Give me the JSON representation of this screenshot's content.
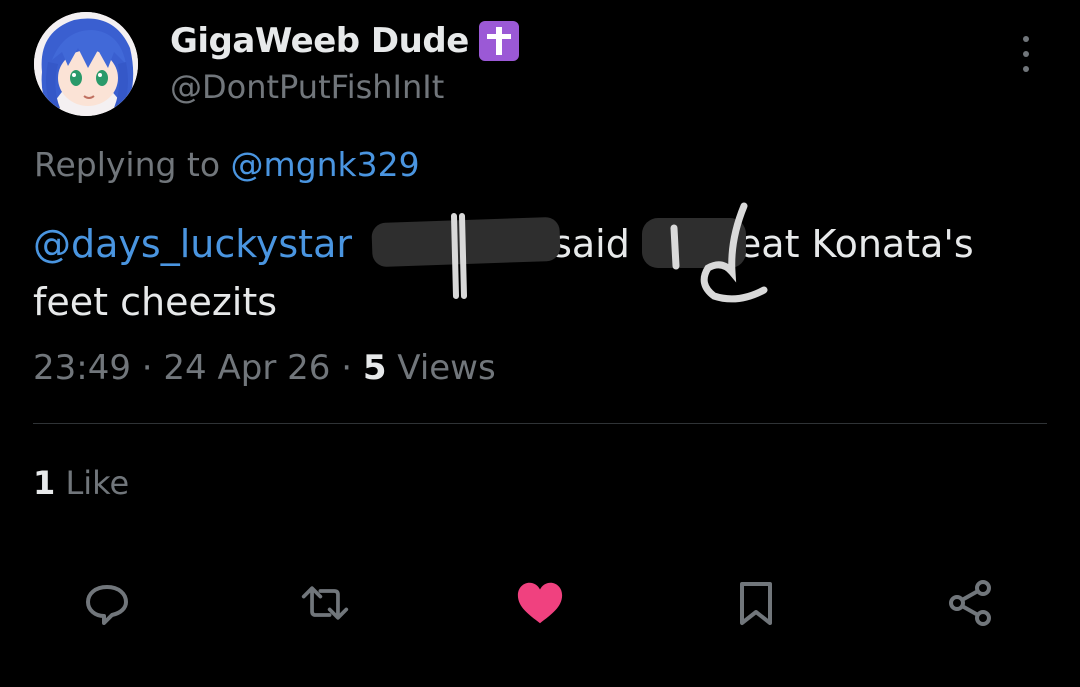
{
  "author": {
    "display_name": "GigaWeeb Dude",
    "handle": "@DontPutFishInIt",
    "badge_icon": "latin-cross-icon",
    "badge_color": "#9b59d6"
  },
  "reply": {
    "prefix": "Replying to ",
    "mention": "@mgnk329"
  },
  "tweet": {
    "mention": "@days_luckystar",
    "text_part_2": " said ",
    "text_part_3": "eat Konata's",
    "text_part_4": "feet cheezits"
  },
  "meta": {
    "time": "23:49",
    "separator": " · ",
    "date": "24 Apr 26",
    "views_count": "5",
    "views_label": " Views"
  },
  "engagement": {
    "likes_count": "1",
    "likes_label": " Like"
  },
  "actions": {
    "reply_icon": "speech-bubble-icon",
    "repost_icon": "repost-arrows-icon",
    "like_icon": "heart-icon",
    "bookmark_icon": "bookmark-icon",
    "share_icon": "share-nodes-icon"
  },
  "colors": {
    "background": "#000000",
    "text_primary": "#e7e9ea",
    "text_secondary": "#71767b",
    "link": "#4a95e0",
    "like_active": "#f0417f",
    "divider": "#2f3336"
  }
}
